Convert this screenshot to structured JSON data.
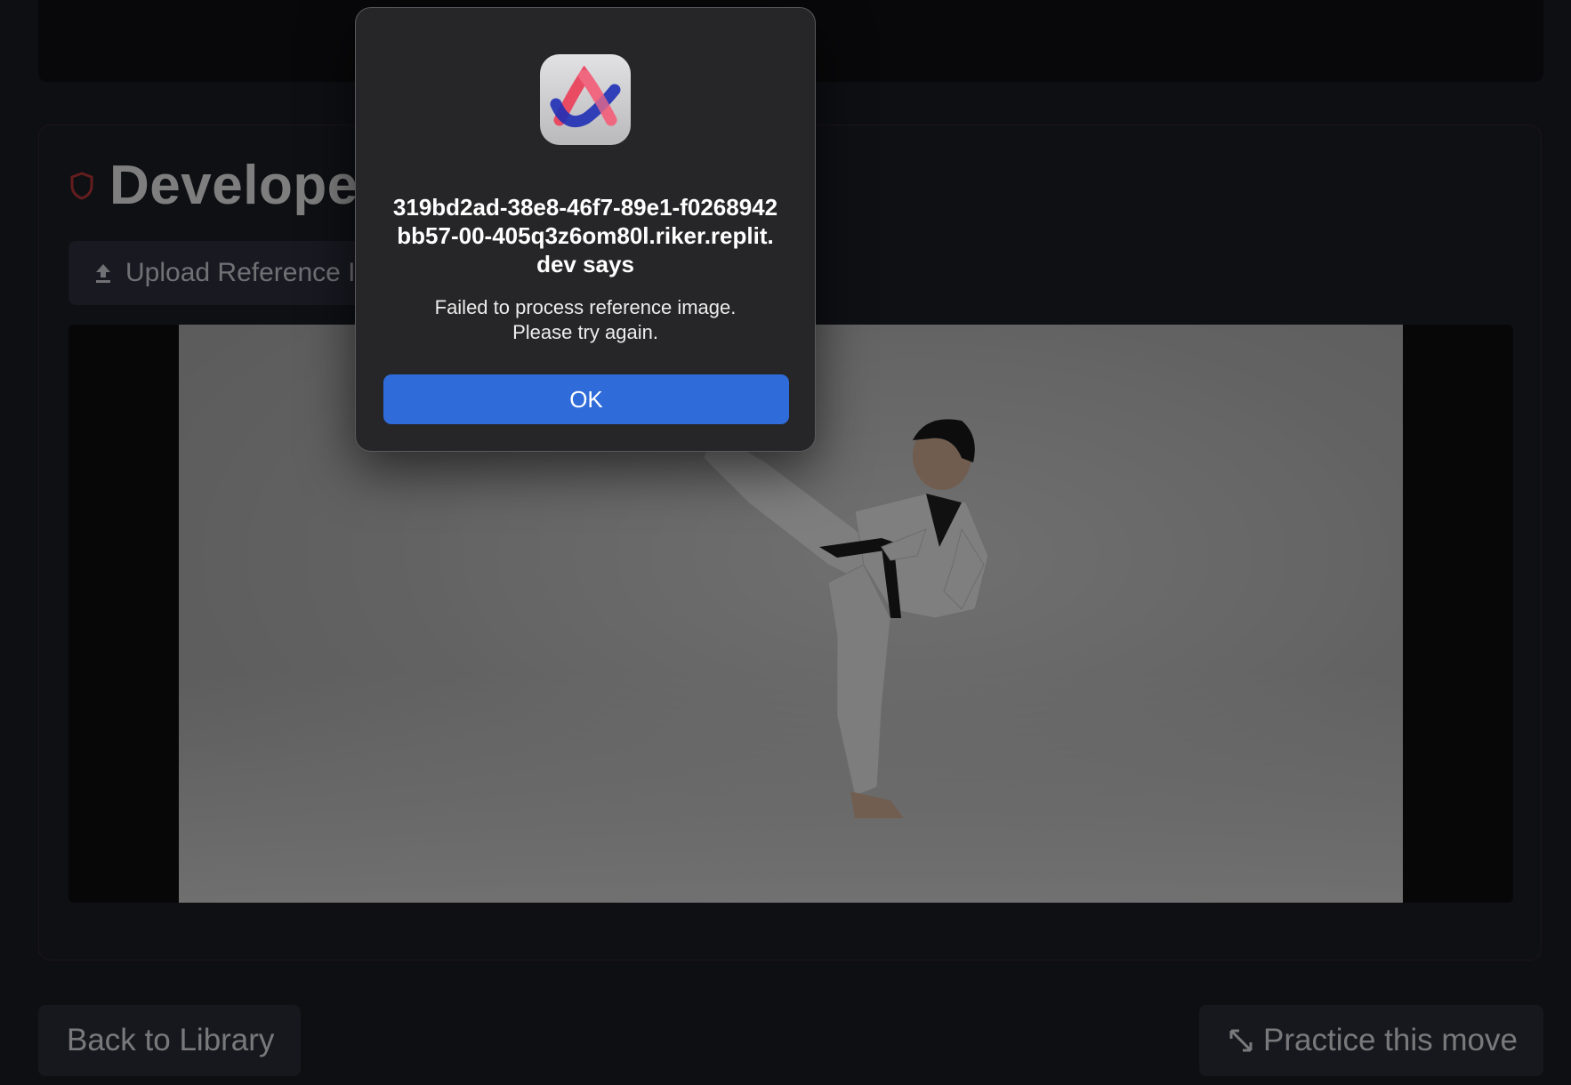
{
  "page": {
    "panel_title": "Developer Tools",
    "upload_button_label": "Upload Reference Image",
    "back_button_label": "Back to Library",
    "practice_button_label": "Practice this move",
    "reference_image_subject": "Taekwondo practitioner in white dobok with black belt performing a high side kick"
  },
  "icons": {
    "panel": "shield-icon",
    "upload": "upload-icon",
    "practice": "expand-arrows-icon",
    "dialog_app": "arc-browser-icon"
  },
  "dialog": {
    "title": "319bd2ad-38e8-46f7-89e1-f0268942bb57-00-405q3z6om80l.riker.replit.dev says",
    "message_line1": "Failed to process reference image.",
    "message_line2": "Please try again.",
    "ok_label": "OK"
  },
  "colors": {
    "background": "#1b1d25",
    "accent_red": "#c0393b",
    "ok_blue": "#2f6bd9"
  }
}
